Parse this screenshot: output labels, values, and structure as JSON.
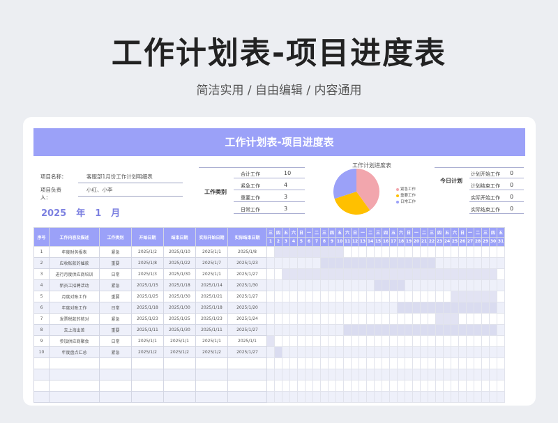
{
  "header": {
    "title": "工作计划表-项目进度表",
    "subtitle": "简洁实用 / 自由编辑 / 内容通用"
  },
  "sheet": {
    "banner": "工作计划表-项目进度表",
    "project_name_label": "项目名称：",
    "project_name": "客服部1月份工作计划明细表",
    "owner_label": "项目负责人：",
    "owner": "小红、小李",
    "year": "2025",
    "year_unit": "年",
    "month": "1",
    "month_unit": "月"
  },
  "category_summary": {
    "heading": "工作类别",
    "rows": [
      {
        "label": "合计工作",
        "value": "10"
      },
      {
        "label": "紧急工作",
        "value": "4"
      },
      {
        "label": "重要工作",
        "value": "3"
      },
      {
        "label": "日常工作",
        "value": "3"
      }
    ]
  },
  "today_plan": {
    "heading": "今日计划",
    "rows": [
      {
        "label": "计划开始工作",
        "value": "0"
      },
      {
        "label": "计划结束工作",
        "value": "0"
      },
      {
        "label": "实际开始工作",
        "value": "0"
      },
      {
        "label": "实际结束工作",
        "value": "0"
      }
    ]
  },
  "chart_data": {
    "type": "pie",
    "title": "工作计划进度表",
    "categories": [
      "紧急工作",
      "重要工作",
      "日常工作"
    ],
    "values": [
      4,
      3,
      3
    ],
    "colors": [
      "#f2a6ad",
      "#ffc000",
      "#9ba1f8"
    ],
    "legend": "right"
  },
  "table": {
    "columns": [
      "序号",
      "工作内容及描述",
      "工作类别",
      "开始日期",
      "结束日期",
      "实际开始日期",
      "实际结束日期"
    ],
    "weekdays": [
      "三",
      "四",
      "五",
      "六",
      "日",
      "一",
      "二",
      "三",
      "四",
      "五",
      "六",
      "日",
      "一",
      "二",
      "三",
      "四",
      "五",
      "六",
      "日",
      "一",
      "二",
      "三",
      "四",
      "五",
      "六",
      "日",
      "一",
      "二",
      "三",
      "四",
      "五"
    ],
    "days": [
      "1",
      "2",
      "3",
      "4",
      "5",
      "6",
      "7",
      "8",
      "9",
      "10",
      "11",
      "12",
      "13",
      "14",
      "15",
      "16",
      "17",
      "18",
      "19",
      "20",
      "21",
      "22",
      "23",
      "24",
      "25",
      "26",
      "27",
      "28",
      "29",
      "30",
      "31"
    ],
    "rows": [
      {
        "no": "1",
        "task": "年度财务报表",
        "cat": "紧急",
        "start": "2025/1/2",
        "end": "2025/1/10",
        "astart": "2025/1/1",
        "aend": "2025/1/8"
      },
      {
        "no": "2",
        "task": "应收账款的催款",
        "cat": "重要",
        "start": "2025/1/8",
        "end": "2025/1/22",
        "astart": "2025/1/7",
        "aend": "2025/1/23"
      },
      {
        "no": "3",
        "task": "进行月度供应商培训",
        "cat": "日常",
        "start": "2025/1/3",
        "end": "2025/1/30",
        "astart": "2025/1/1",
        "aend": "2025/1/27"
      },
      {
        "no": "4",
        "task": "新员工招聘活动",
        "cat": "紧急",
        "start": "2025/1/15",
        "end": "2025/1/18",
        "astart": "2025/1/14",
        "aend": "2025/1/30"
      },
      {
        "no": "5",
        "task": "月度对账工作",
        "cat": "重要",
        "start": "2025/1/25",
        "end": "2025/1/30",
        "astart": "2025/1/21",
        "aend": "2025/1/27"
      },
      {
        "no": "6",
        "task": "年度对账工作",
        "cat": "日常",
        "start": "2025/1/18",
        "end": "2025/1/30",
        "astart": "2025/1/18",
        "aend": "2025/1/20"
      },
      {
        "no": "7",
        "task": "发票税款的核对",
        "cat": "紧急",
        "start": "2025/1/23",
        "end": "2025/1/25",
        "astart": "2025/1/23",
        "aend": "2025/1/24"
      },
      {
        "no": "8",
        "task": "去上海出差",
        "cat": "重要",
        "start": "2025/1/11",
        "end": "2025/1/30",
        "astart": "2025/1/11",
        "aend": "2025/1/27"
      },
      {
        "no": "9",
        "task": "参加供应商聚会",
        "cat": "日常",
        "start": "2025/1/1",
        "end": "2025/1/1",
        "astart": "2025/1/1",
        "aend": "2025/1/1"
      },
      {
        "no": "10",
        "task": "年度盘点汇总",
        "cat": "紧急",
        "start": "2025/1/2",
        "end": "2025/1/2",
        "astart": "2025/1/2",
        "aend": "2025/1/27"
      },
      {
        "no": "",
        "task": "",
        "cat": "",
        "start": "",
        "end": "",
        "astart": "",
        "aend": ""
      },
      {
        "no": "",
        "task": "",
        "cat": "",
        "start": "",
        "end": "",
        "astart": "",
        "aend": ""
      },
      {
        "no": "",
        "task": "",
        "cat": "",
        "start": "",
        "end": "",
        "astart": "",
        "aend": ""
      },
      {
        "no": "",
        "task": "",
        "cat": "",
        "start": "",
        "end": "",
        "astart": "",
        "aend": ""
      }
    ]
  }
}
